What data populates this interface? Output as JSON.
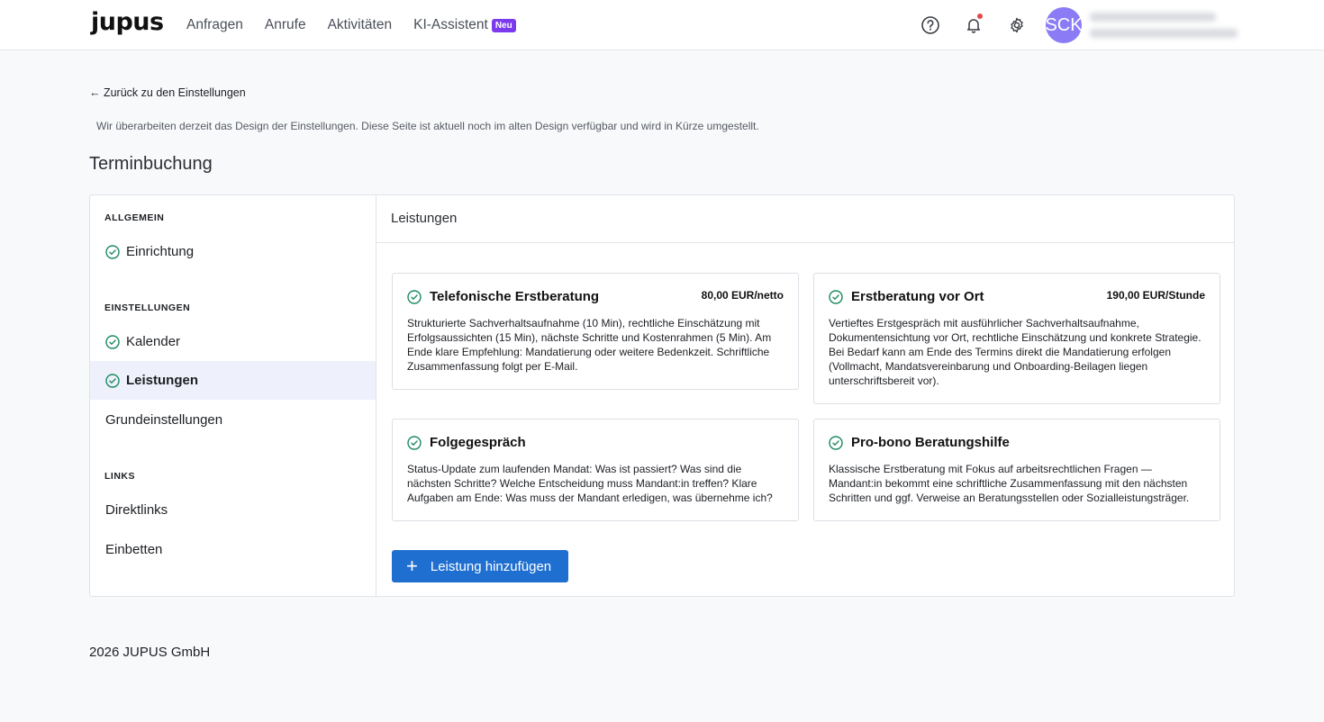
{
  "brand": {
    "logo": "jupus"
  },
  "nav": {
    "items": [
      {
        "label": "Anfragen"
      },
      {
        "label": "Anrufe"
      },
      {
        "label": "Aktivitäten"
      },
      {
        "label": "KI-Assistent",
        "badge": "Neu"
      }
    ]
  },
  "header": {
    "avatar_initials": "SCK"
  },
  "back_link": "← Zurück zu den Einstellungen",
  "notice": "Wir überarbeiten derzeit das Design der Einstellungen. Diese Seite ist aktuell noch im alten Design verfügbar und wird in Kürze umgestellt.",
  "page_title": "Terminbuchung",
  "sidebar": {
    "sections": [
      {
        "label": "ALLGEMEIN",
        "items": [
          {
            "label": "Einrichtung",
            "checked": true
          }
        ]
      },
      {
        "label": "EINSTELLUNGEN",
        "items": [
          {
            "label": "Kalender",
            "checked": true
          },
          {
            "label": "Leistungen",
            "checked": true,
            "active": true
          },
          {
            "label": "Grundeinstellungen",
            "checked": false
          }
        ]
      },
      {
        "label": "LINKS",
        "items": [
          {
            "label": "Direktlinks",
            "checked": false
          },
          {
            "label": "Einbetten",
            "checked": false
          }
        ]
      }
    ]
  },
  "content": {
    "title": "Leistungen",
    "services": [
      {
        "title": "Telefonische Erstberatung",
        "price": "80,00 EUR/netto",
        "description": "Strukturierte Sachverhaltsaufnahme (10 Min), rechtliche Einschätzung mit Erfolgsaussichten (15 Min), nächste Schritte und Kostenrahmen (5 Min). Am Ende klare Empfehlung: Mandatierung oder weitere Bedenkzeit. Schriftliche Zusammenfassung folgt per E-Mail."
      },
      {
        "title": "Erstberatung vor Ort",
        "price": "190,00 EUR/Stunde",
        "description": "Vertieftes Erstgespräch mit ausführlicher Sachverhaltsaufnahme, Dokumentensichtung vor Ort, rechtliche Einschätzung und konkrete Strategie. Bei Bedarf kann am Ende des Termins direkt die Mandatierung erfolgen (Vollmacht, Mandatsvereinbarung und Onboarding-Beilagen liegen unterschriftsbereit vor)."
      },
      {
        "title": "Folgegespräch",
        "price": "",
        "description": "Status-Update zum laufenden Mandat: Was ist passiert? Was sind die nächsten Schritte? Welche Entscheidung muss Mandant:in treffen? Klare Aufgaben am Ende: Was muss der Mandant erledigen, was übernehme ich?"
      },
      {
        "title": "Pro-bono Beratungshilfe",
        "price": "",
        "description": "Klassische Erstberatung mit Fokus auf arbeitsrechtlichen Fragen — Mandant:in bekommt eine schriftliche Zusammenfassung mit den nächsten Schritten und ggf. Verweise an Beratungsstellen oder Sozialleistungsträger."
      }
    ],
    "add_button": "Leistung hinzufügen"
  },
  "footer": "2026 JUPUS GmbH",
  "colors": {
    "accent": "#1f6fd1",
    "check": "#1a8a5f",
    "badge": "#7c3aed",
    "avatar": "#8b7cf6"
  }
}
